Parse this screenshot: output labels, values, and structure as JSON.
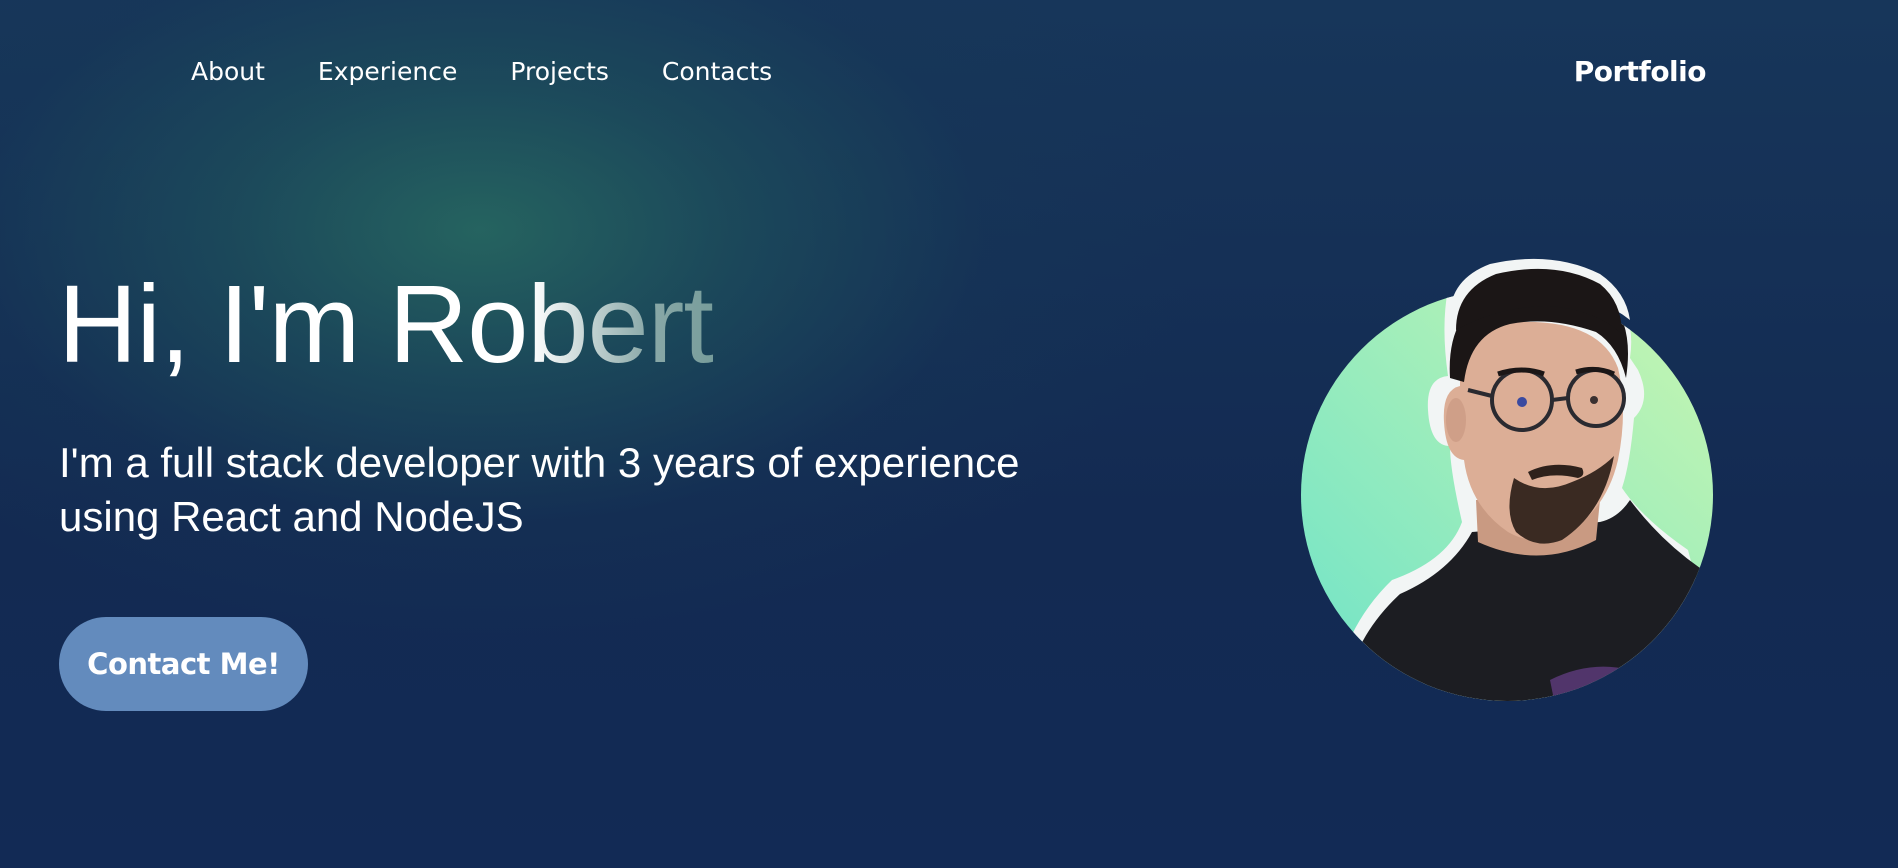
{
  "nav": {
    "links": [
      {
        "label": "About"
      },
      {
        "label": "Experience"
      },
      {
        "label": "Projects"
      },
      {
        "label": "Contacts"
      }
    ],
    "brand": "Portfolio"
  },
  "hero": {
    "title": "Hi, I'm Robert",
    "subtitle": "I'm a full stack developer with 3 years of experience using React and NodeJS",
    "cta_label": "Contact Me!"
  },
  "colors": {
    "background": "#132a52",
    "background_glow": "#26665f",
    "button": "#638bbd",
    "portrait_gradient_start": "#6ee3c8",
    "portrait_gradient_end": "#c9f6b0"
  },
  "portrait": {
    "icon": "profile-photo-avatar"
  }
}
